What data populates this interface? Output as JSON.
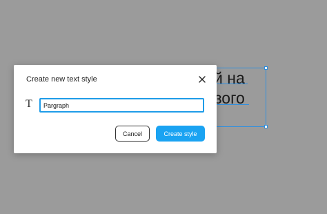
{
  "canvas": {
    "text_line_1": "й на",
    "text_line_2": "зого"
  },
  "dialog": {
    "title": "Create new text style",
    "close_icon": "close-icon",
    "type_icon": "text-type-icon",
    "type_icon_glyph": "T",
    "name_input_value": "Pargraph",
    "cancel_label": "Cancel",
    "create_label": "Create style"
  },
  "colors": {
    "accent": "#1aa3f2",
    "input_focus": "#1e9ce8",
    "selection": "#2e8fe0",
    "backdrop": "#9b9b9b"
  }
}
